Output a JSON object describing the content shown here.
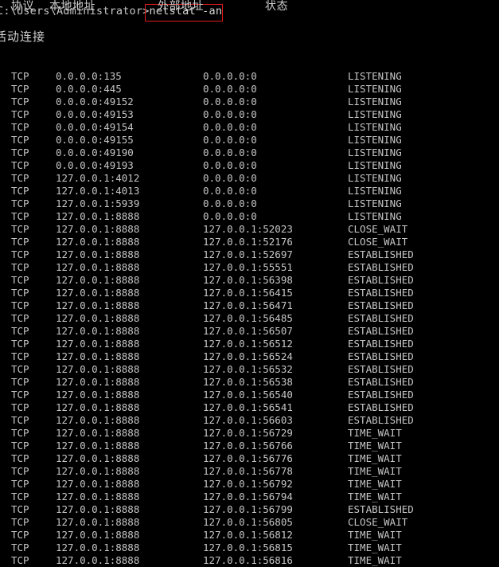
{
  "window": {
    "background_color": "#000000",
    "text_color": "#c6c6c6",
    "highlight_color": "#e01b1b"
  },
  "prompt": {
    "path": "C:\\Users\\Administrator>",
    "command": "netstat -an"
  },
  "output": {
    "section_title": "活动连接",
    "columns": {
      "protocol": "协议",
      "local_address": "本地地址",
      "foreign_address": "外部地址",
      "state": "状态"
    },
    "rows": [
      {
        "protocol": "TCP",
        "local": "0.0.0.0:135",
        "foreign": "0.0.0.0:0",
        "state": "LISTENING"
      },
      {
        "protocol": "TCP",
        "local": "0.0.0.0:445",
        "foreign": "0.0.0.0:0",
        "state": "LISTENING"
      },
      {
        "protocol": "TCP",
        "local": "0.0.0.0:49152",
        "foreign": "0.0.0.0:0",
        "state": "LISTENING"
      },
      {
        "protocol": "TCP",
        "local": "0.0.0.0:49153",
        "foreign": "0.0.0.0:0",
        "state": "LISTENING"
      },
      {
        "protocol": "TCP",
        "local": "0.0.0.0:49154",
        "foreign": "0.0.0.0:0",
        "state": "LISTENING"
      },
      {
        "protocol": "TCP",
        "local": "0.0.0.0:49155",
        "foreign": "0.0.0.0:0",
        "state": "LISTENING"
      },
      {
        "protocol": "TCP",
        "local": "0.0.0.0:49190",
        "foreign": "0.0.0.0:0",
        "state": "LISTENING"
      },
      {
        "protocol": "TCP",
        "local": "0.0.0.0:49193",
        "foreign": "0.0.0.0:0",
        "state": "LISTENING"
      },
      {
        "protocol": "TCP",
        "local": "127.0.0.1:4012",
        "foreign": "0.0.0.0:0",
        "state": "LISTENING"
      },
      {
        "protocol": "TCP",
        "local": "127.0.0.1:4013",
        "foreign": "0.0.0.0:0",
        "state": "LISTENING"
      },
      {
        "protocol": "TCP",
        "local": "127.0.0.1:5939",
        "foreign": "0.0.0.0:0",
        "state": "LISTENING"
      },
      {
        "protocol": "TCP",
        "local": "127.0.0.1:8888",
        "foreign": "0.0.0.0:0",
        "state": "LISTENING"
      },
      {
        "protocol": "TCP",
        "local": "127.0.0.1:8888",
        "foreign": "127.0.0.1:52023",
        "state": "CLOSE_WAIT"
      },
      {
        "protocol": "TCP",
        "local": "127.0.0.1:8888",
        "foreign": "127.0.0.1:52176",
        "state": "CLOSE_WAIT"
      },
      {
        "protocol": "TCP",
        "local": "127.0.0.1:8888",
        "foreign": "127.0.0.1:52697",
        "state": "ESTABLISHED"
      },
      {
        "protocol": "TCP",
        "local": "127.0.0.1:8888",
        "foreign": "127.0.0.1:55551",
        "state": "ESTABLISHED"
      },
      {
        "protocol": "TCP",
        "local": "127.0.0.1:8888",
        "foreign": "127.0.0.1:56398",
        "state": "ESTABLISHED"
      },
      {
        "protocol": "TCP",
        "local": "127.0.0.1:8888",
        "foreign": "127.0.0.1:56415",
        "state": "ESTABLISHED"
      },
      {
        "protocol": "TCP",
        "local": "127.0.0.1:8888",
        "foreign": "127.0.0.1:56471",
        "state": "ESTABLISHED"
      },
      {
        "protocol": "TCP",
        "local": "127.0.0.1:8888",
        "foreign": "127.0.0.1:56485",
        "state": "ESTABLISHED"
      },
      {
        "protocol": "TCP",
        "local": "127.0.0.1:8888",
        "foreign": "127.0.0.1:56507",
        "state": "ESTABLISHED"
      },
      {
        "protocol": "TCP",
        "local": "127.0.0.1:8888",
        "foreign": "127.0.0.1:56512",
        "state": "ESTABLISHED"
      },
      {
        "protocol": "TCP",
        "local": "127.0.0.1:8888",
        "foreign": "127.0.0.1:56524",
        "state": "ESTABLISHED"
      },
      {
        "protocol": "TCP",
        "local": "127.0.0.1:8888",
        "foreign": "127.0.0.1:56532",
        "state": "ESTABLISHED"
      },
      {
        "protocol": "TCP",
        "local": "127.0.0.1:8888",
        "foreign": "127.0.0.1:56538",
        "state": "ESTABLISHED"
      },
      {
        "protocol": "TCP",
        "local": "127.0.0.1:8888",
        "foreign": "127.0.0.1:56540",
        "state": "ESTABLISHED"
      },
      {
        "protocol": "TCP",
        "local": "127.0.0.1:8888",
        "foreign": "127.0.0.1:56541",
        "state": "ESTABLISHED"
      },
      {
        "protocol": "TCP",
        "local": "127.0.0.1:8888",
        "foreign": "127.0.0.1:56603",
        "state": "ESTABLISHED"
      },
      {
        "protocol": "TCP",
        "local": "127.0.0.1:8888",
        "foreign": "127.0.0.1:56729",
        "state": "TIME_WAIT"
      },
      {
        "protocol": "TCP",
        "local": "127.0.0.1:8888",
        "foreign": "127.0.0.1:56766",
        "state": "TIME_WAIT"
      },
      {
        "protocol": "TCP",
        "local": "127.0.0.1:8888",
        "foreign": "127.0.0.1:56776",
        "state": "TIME_WAIT"
      },
      {
        "protocol": "TCP",
        "local": "127.0.0.1:8888",
        "foreign": "127.0.0.1:56778",
        "state": "TIME_WAIT"
      },
      {
        "protocol": "TCP",
        "local": "127.0.0.1:8888",
        "foreign": "127.0.0.1:56792",
        "state": "TIME_WAIT"
      },
      {
        "protocol": "TCP",
        "local": "127.0.0.1:8888",
        "foreign": "127.0.0.1:56794",
        "state": "TIME_WAIT"
      },
      {
        "protocol": "TCP",
        "local": "127.0.0.1:8888",
        "foreign": "127.0.0.1:56799",
        "state": "ESTABLISHED"
      },
      {
        "protocol": "TCP",
        "local": "127.0.0.1:8888",
        "foreign": "127.0.0.1:56805",
        "state": "CLOSE_WAIT"
      },
      {
        "protocol": "TCP",
        "local": "127.0.0.1:8888",
        "foreign": "127.0.0.1:56812",
        "state": "TIME_WAIT"
      },
      {
        "protocol": "TCP",
        "local": "127.0.0.1:8888",
        "foreign": "127.0.0.1:56815",
        "state": "TIME_WAIT"
      },
      {
        "protocol": "TCP",
        "local": "127.0.0.1:8888",
        "foreign": "127.0.0.1:56816",
        "state": "TIME_WAIT"
      }
    ]
  }
}
